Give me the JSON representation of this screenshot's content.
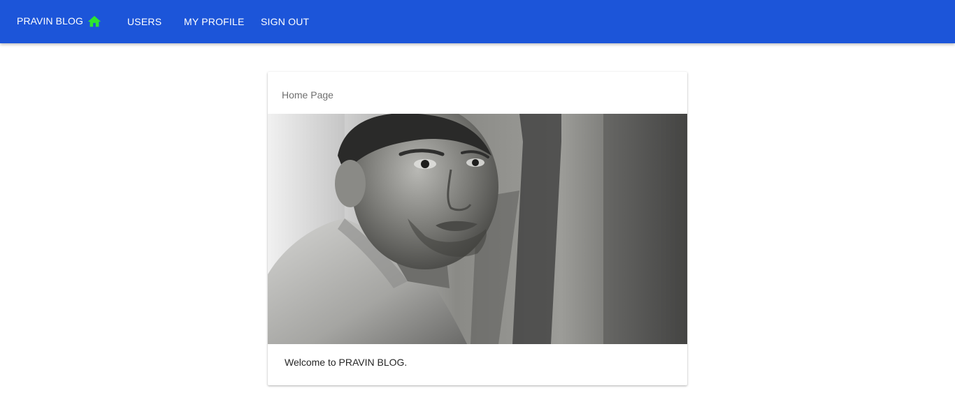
{
  "header": {
    "brand": "PRAVIN BLOG",
    "home_icon": "home-icon",
    "home_icon_color": "#2ee62e",
    "bar_color": "#1c55d9",
    "nav": [
      {
        "label": "USERS"
      },
      {
        "label": "MY PROFILE"
      },
      {
        "label": "SIGN OUT"
      }
    ]
  },
  "card": {
    "title": "Home Page",
    "image": "grayscale portrait photo of a young man leaning against a wall",
    "body": "Welcome to PRAVIN BLOG."
  }
}
